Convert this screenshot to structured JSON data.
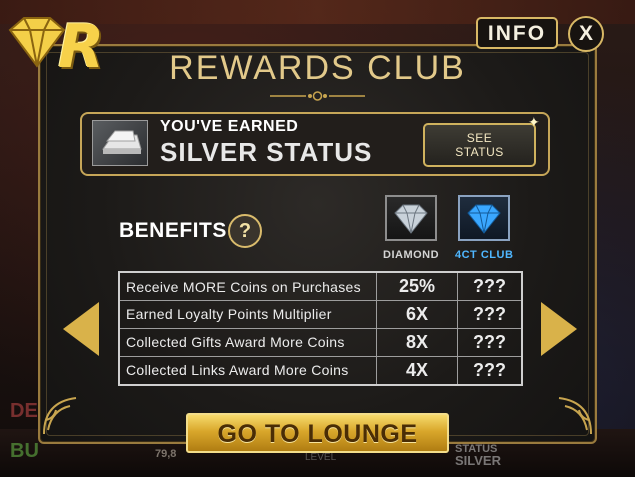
{
  "header": {
    "info_label": "INFO",
    "close_label": "X"
  },
  "title": "REWARDS CLUB",
  "status": {
    "earned_label": "YOU'VE EARNED",
    "status_name": "SILVER STATUS",
    "see_status_label": "SEE STATUS"
  },
  "benefits": {
    "heading": "BENEFITS",
    "help_label": "?",
    "tiers": [
      {
        "name": "DIAMOND",
        "color": "#d4d4d4",
        "icon": "diamond-gem-icon"
      },
      {
        "name": "4CT CLUB",
        "color": "#4fb7ff",
        "icon": "blue-diamond-gem-icon"
      }
    ],
    "rows": [
      {
        "label": "Receive MORE Coins on Purchases",
        "diamond": "25%",
        "club": "???"
      },
      {
        "label": "Earned Loyalty Points Multiplier",
        "diamond": "6X",
        "club": "???"
      },
      {
        "label": "Collected Gifts Award More Coins",
        "diamond": "8X",
        "club": "???"
      },
      {
        "label": "Collected Links Award More Coins",
        "diamond": "4X",
        "club": "???"
      }
    ]
  },
  "lounge_button_label": "GO TO LOUNGE",
  "background": {
    "coins_value": "79,8",
    "status_label": "STATUS",
    "status_value": "SILVER",
    "level_label": "LEVEL"
  },
  "colors": {
    "gold_accent": "#d9b24a",
    "club_blue": "#4fb7ff",
    "panel_border": "#9a7b3e"
  }
}
